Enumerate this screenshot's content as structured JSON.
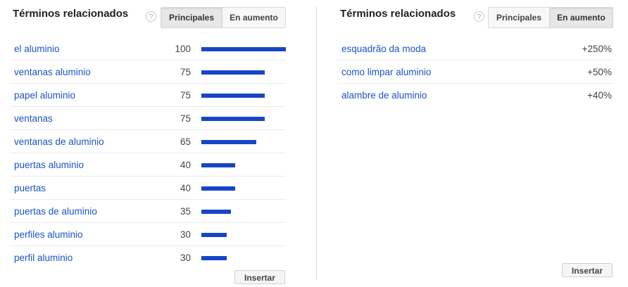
{
  "left": {
    "title": "Términos relacionados",
    "help": "?",
    "tabs": [
      {
        "label": "Principales",
        "active": true
      },
      {
        "label": "En aumento",
        "active": false
      }
    ],
    "rows": [
      {
        "term": "el aluminio",
        "value": "100",
        "level": 100
      },
      {
        "term": "ventanas aluminio",
        "value": "75",
        "level": 75
      },
      {
        "term": "papel aluminio",
        "value": "75",
        "level": 75
      },
      {
        "term": "ventanas",
        "value": "75",
        "level": 75
      },
      {
        "term": "ventanas de aluminio",
        "value": "65",
        "level": 65
      },
      {
        "term": "puertas aluminio",
        "value": "40",
        "level": 40
      },
      {
        "term": "puertas",
        "value": "40",
        "level": 40
      },
      {
        "term": "puertas de aluminio",
        "value": "35",
        "level": 35
      },
      {
        "term": "perfiles aluminio",
        "value": "30",
        "level": 30
      },
      {
        "term": "perfil aluminio",
        "value": "30",
        "level": 30
      }
    ],
    "insert_label": "Insertar"
  },
  "right": {
    "title": "Términos relacionados",
    "help": "?",
    "tabs": [
      {
        "label": "Principales",
        "active": false
      },
      {
        "label": "En aumento",
        "active": true
      }
    ],
    "rows": [
      {
        "term": "esquadrão da moda",
        "value": "+250%"
      },
      {
        "term": "como limpar aluminio",
        "value": "+50%"
      },
      {
        "term": "alambre de aluminio",
        "value": "+40%"
      }
    ],
    "insert_label": "Insertar"
  },
  "colors": {
    "bar": "#1645c8",
    "link": "#1a55c4"
  }
}
